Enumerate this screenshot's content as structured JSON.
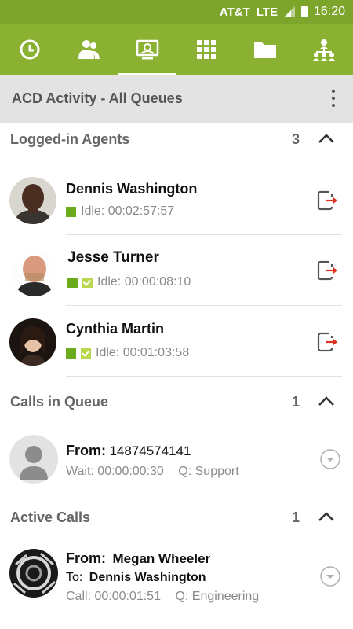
{
  "status_bar": {
    "carrier": "AT&T",
    "network": "LTE",
    "time": "16:20"
  },
  "tabs": [
    {
      "icon": "clock-icon"
    },
    {
      "icon": "contacts-icon"
    },
    {
      "icon": "acd-monitor-icon",
      "active": true
    },
    {
      "icon": "dialpad-icon"
    },
    {
      "icon": "folder-icon"
    },
    {
      "icon": "org-chart-icon"
    }
  ],
  "header": {
    "title": "ACD Activity - All Queues"
  },
  "logged_in": {
    "label": "Logged-in Agents",
    "count": "3",
    "agents": [
      {
        "name": "Dennis Washington",
        "status": "Idle: 00:02:57:57"
      },
      {
        "name": "Jesse Turner",
        "status": "Idle: 00:00:08:10"
      },
      {
        "name": "Cynthia Martin",
        "status": "Idle: 00:01:03:58"
      }
    ]
  },
  "queue": {
    "label": "Calls in Queue",
    "count": "1",
    "calls": [
      {
        "from_label": "From:",
        "from": "14874574141",
        "wait": "Wait: 00:00:00:30",
        "queue": "Q: Support"
      }
    ]
  },
  "active": {
    "label": "Active Calls",
    "count": "1",
    "calls": [
      {
        "from_label": "From:",
        "from": "Megan Wheeler",
        "to_label": "To:",
        "to": "Dennis Washington",
        "duration": "Call: 00:00:01:51",
        "queue": "Q: Engineering"
      }
    ]
  },
  "colors": {
    "brand_green": "#8bb132",
    "status_green": "#6cab1e",
    "logout_red": "#e0301e"
  }
}
